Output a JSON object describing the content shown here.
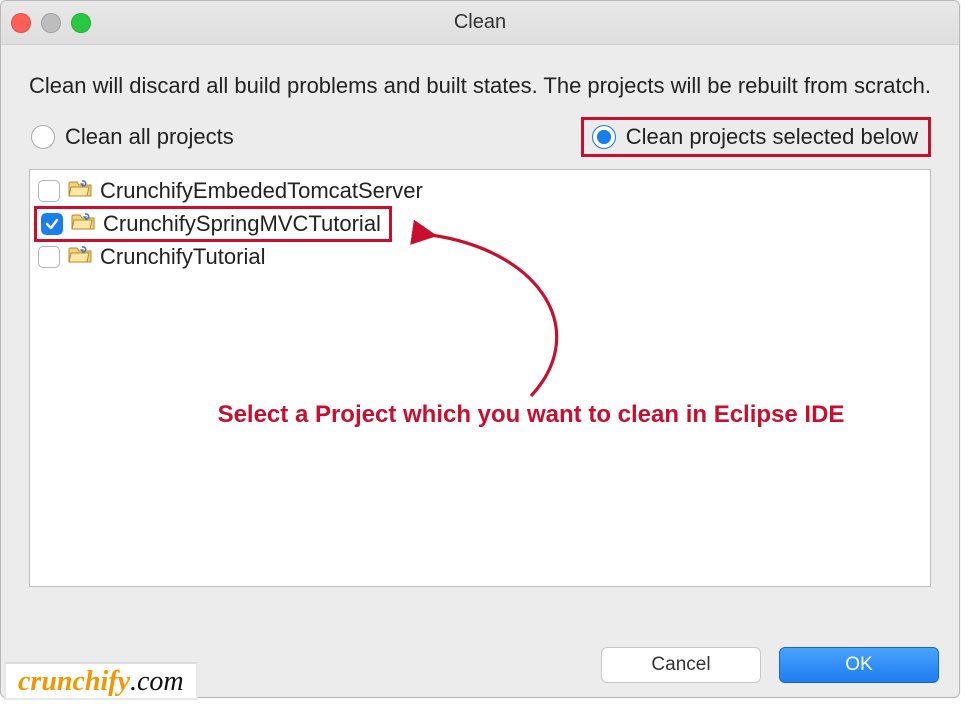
{
  "window": {
    "title": "Clean"
  },
  "description": "Clean will discard all build problems and built states.  The projects will be rebuilt from scratch.",
  "radios": {
    "all": {
      "label": "Clean all projects",
      "checked": false
    },
    "selected": {
      "label": "Clean projects selected below",
      "checked": true
    }
  },
  "projects": [
    {
      "name": "CrunchifyEmbededTomcatServer",
      "checked": false
    },
    {
      "name": "CrunchifySpringMVCTutorial",
      "checked": true,
      "highlighted": true
    },
    {
      "name": "CrunchifyTutorial",
      "checked": false
    }
  ],
  "annotation": "Select a Project which you want to clean in Eclipse IDE",
  "buttons": {
    "cancel": "Cancel",
    "ok": "OK"
  },
  "watermark": {
    "brand": "crunchify",
    "suffix": ".com"
  },
  "colors": {
    "annotation": "#c8102e",
    "primary": "#1a7fee"
  }
}
